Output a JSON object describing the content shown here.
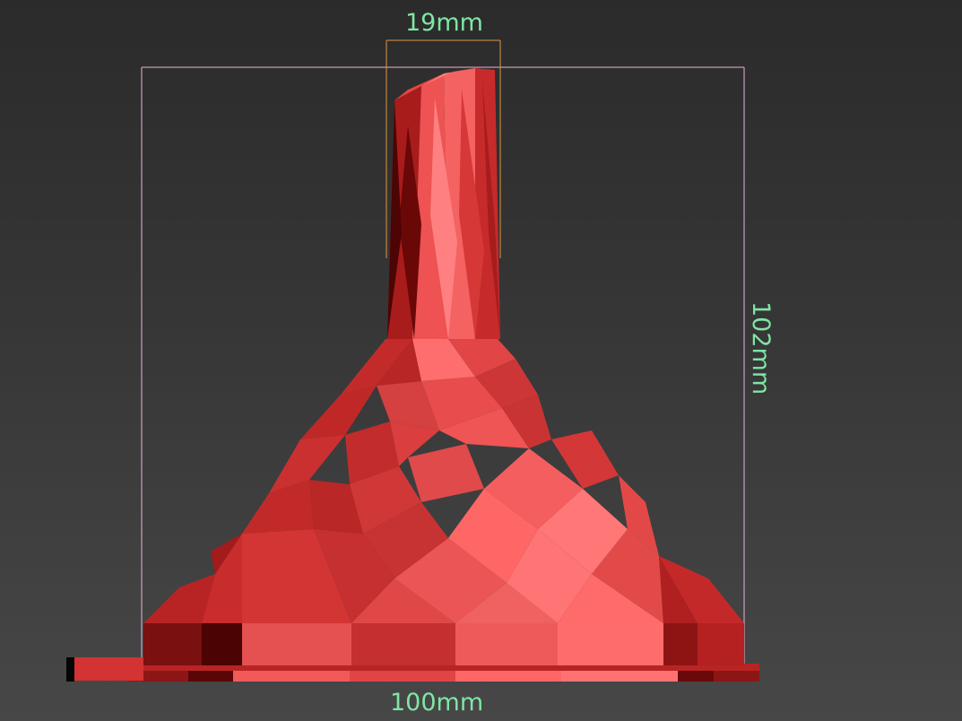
{
  "viewport": {
    "background_top": "#2b2b2b",
    "background_bottom": "#474747"
  },
  "model": {
    "name": "low-poly-funnel",
    "color_base": "#d93a3a",
    "color_light": "#ff7070",
    "color_dark": "#7a1010"
  },
  "dimensions": {
    "neck_diameter": "19mm",
    "base_width": "100mm",
    "height": "102mm",
    "label_color": "#7fe6a4",
    "box_color": "#e8b4d8",
    "neck_box_color": "#e0963c"
  }
}
